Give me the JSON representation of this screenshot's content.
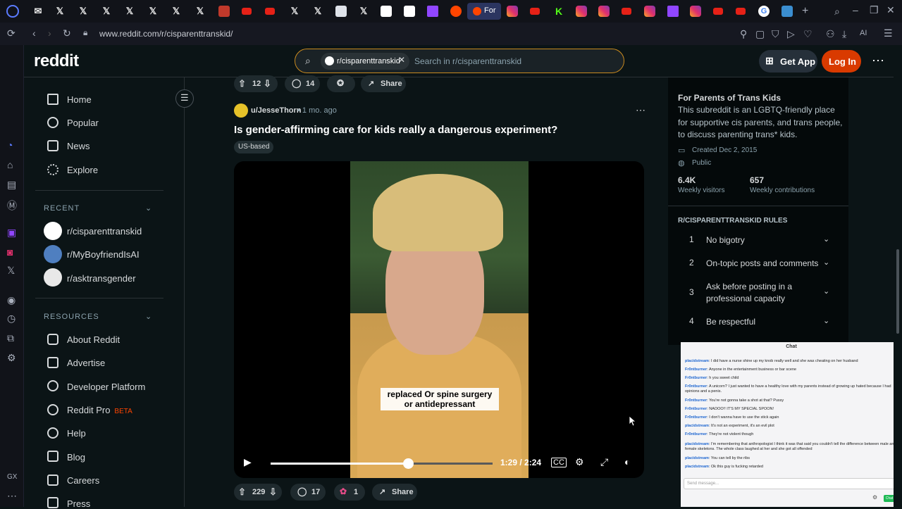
{
  "browser": {
    "active_tab_label": "For",
    "url": "www.reddit.com/r/cisparenttranskid/",
    "ai_label": "AI",
    "tab_icons": [
      "x-icon",
      "x-icon",
      "x-icon",
      "x-icon",
      "x-icon",
      "x-icon",
      "youtube-icon",
      "youtube-icon",
      "x-icon",
      "x-icon",
      "x-icon",
      "youtube-icon",
      "twitch-icon",
      "reddit-icon",
      "instagram-icon",
      "youtube-icon",
      "kick-icon",
      "instagram-icon",
      "instagram-icon",
      "youtube-icon",
      "instagram-icon",
      "twitch-icon",
      "instagram-icon",
      "youtube-icon",
      "youtube-icon",
      "chrome-icon"
    ]
  },
  "header": {
    "logo": "reddit",
    "search_chip": "r/cisparenttranskid",
    "search_placeholder": "Search in r/cisparenttranskid",
    "get_app": "Get App",
    "log_in": "Log In"
  },
  "nav": {
    "main": [
      {
        "label": "Home",
        "icon": "home-icon"
      },
      {
        "label": "Popular",
        "icon": "popular-icon"
      },
      {
        "label": "News",
        "icon": "news-icon"
      },
      {
        "label": "Explore",
        "icon": "explore-icon"
      }
    ],
    "recent_heading": "RECENT",
    "recent": [
      "r/cisparenttranskid",
      "r/MyBoyfriendIsAI",
      "r/asktransgender"
    ],
    "resources_heading": "RESOURCES",
    "resources": [
      "About Reddit",
      "Advertise",
      "Developer Platform",
      "Reddit Pro",
      "Help",
      "Blog",
      "Careers",
      "Press"
    ],
    "beta_badge": "BETA"
  },
  "prev_post_actions": {
    "votes": "12",
    "comments": "14",
    "share": "Share"
  },
  "post": {
    "user": "u/JesseThorn",
    "time": "1 mo. ago",
    "title": "Is gender-affirming care for kids really a dangerous experiment?",
    "flair": "US-based",
    "caption": "replaced Or spine surgery or antidepressant",
    "timecode": "1:29 / 2:24",
    "progress_fraction": 0.62,
    "votes": "229",
    "comments": "17",
    "awards": "1",
    "share": "Share"
  },
  "sidebar": {
    "title": "For Parents of Trans Kids",
    "description": "This subreddit is an LGBTQ-friendly place for supportive cis parents, and trans people, to discuss parenting trans* kids.",
    "created": "Created Dec 2, 2015",
    "visibility": "Public",
    "visitors_value": "6.4K",
    "visitors_label": "Weekly visitors",
    "contrib_value": "657",
    "contrib_label": "Weekly contributions",
    "rules_heading": "R/CISPARENTTRANSKID RULES",
    "rules": [
      {
        "num": "1",
        "text": "No bigotry"
      },
      {
        "num": "2",
        "text": "On-topic posts and comments"
      },
      {
        "num": "3",
        "text": "Ask before posting in a professional capacity"
      },
      {
        "num": "4",
        "text": "Be respectful"
      }
    ]
  },
  "chat": {
    "title": "Chat",
    "messages": [
      {
        "user": "placidstream",
        "text": "I did have a nurse shine up my knob really well and she was cheating on her husband"
      },
      {
        "user": "Fr0ntburner",
        "text": "Anyone in the entertainment business or bar scene"
      },
      {
        "user": "Fr0ntburner",
        "text": "h you sweet child"
      },
      {
        "user": "Fr0ntburner",
        "text": "A unicorn? I just wanted to have a healthy love with my parents instead of growing up hated because I had opinions and a penis."
      },
      {
        "user": "Fr0ntburner",
        "text": "You're not gonna take a shot at that? Pussy"
      },
      {
        "user": "Fr0ntburner",
        "text": "NAOOO!! IT'S MY SPECIAL SPOON!"
      },
      {
        "user": "Fr0ntburner",
        "text": "I don't wanna have to use the stick again"
      },
      {
        "user": "placidstream",
        "text": "It's not an experiment, it's an evil plot"
      },
      {
        "user": "Fr0ntburner",
        "text": "They're not violent though"
      },
      {
        "user": "placidstream",
        "text": "I'm remembering that anthropologist I think it was that said you couldn't tell the difference between male and female skeletons. The whole class laughed at her and she got all offended"
      },
      {
        "user": "placidstream",
        "text": "You can tell by the ribs"
      },
      {
        "user": "placidstream",
        "text": "Ok this guy is fucking retarded"
      }
    ],
    "input_placeholder": "Send message...",
    "send_label": "Chat"
  }
}
